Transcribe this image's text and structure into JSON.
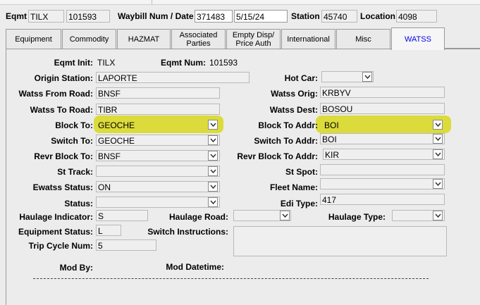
{
  "header": {
    "eqmt_label": "Eqmt",
    "eqmt_init": "TILX",
    "eqmt_num": "101593",
    "waybill_label": "Waybill Num / Date",
    "waybill_num": "371483",
    "waybill_date": "5/15/24",
    "station_label": "Station",
    "station": "45740",
    "location_label": "Location",
    "location": "4098"
  },
  "tabs": [
    {
      "label": "Equipment"
    },
    {
      "label": "Commodity"
    },
    {
      "label": "HAZMAT"
    },
    {
      "label": "Associated Parties"
    },
    {
      "label": "Empty Disp/ Price Auth"
    },
    {
      "label": "International"
    },
    {
      "label": "Misc"
    },
    {
      "label": "WATSS"
    }
  ],
  "form": {
    "eqmt_init_label": "Eqmt Init:",
    "eqmt_init": "TILX",
    "eqmt_num_label": "Eqmt Num:",
    "eqmt_num": "101593",
    "origin_station_label": "Origin Station:",
    "origin_station": "LAPORTE",
    "hot_car_label": "Hot Car:",
    "hot_car": "",
    "watss_from_road_label": "Watss From Road:",
    "watss_from_road": "BNSF",
    "watss_orig_label": "Watss Orig:",
    "watss_orig": "KRBYV",
    "watss_to_road_label": "Watss To Road:",
    "watss_to_road": "TIBR",
    "watss_dest_label": "Watss Dest:",
    "watss_dest": "BOSOU",
    "block_to_label": "Block To:",
    "block_to": "GEOCHE",
    "block_to_addr_label": "Block To Addr:",
    "block_to_addr": "BOI",
    "switch_to_label": "Switch To:",
    "switch_to": "GEOCHE",
    "switch_to_addr_label": "Switch To Addr:",
    "switch_to_addr": "BOI",
    "revr_block_to_label": "Revr Block To:",
    "revr_block_to": "BNSF",
    "revr_block_to_addr_label": "Revr Block To Addr:",
    "revr_block_to_addr": "KIR",
    "st_track_label": "St Track:",
    "st_track": "",
    "st_spot_label": "St Spot:",
    "st_spot": "",
    "ewatss_status_label": "Ewatss Status:",
    "ewatss_status": "ON",
    "fleet_name_label": "Fleet Name:",
    "fleet_name": "",
    "status_label": "Status:",
    "status": "",
    "edi_type_label": "Edi Type:",
    "edi_type": "417",
    "haulage_indicator_label": "Haulage Indicator:",
    "haulage_indicator": "S",
    "haulage_road_label": "Haulage Road:",
    "haulage_road": "",
    "haulage_type_label": "Haulage Type:",
    "haulage_type": "",
    "equipment_status_label": "Equipment Status:",
    "equipment_status": "L",
    "switch_instructions_label": "Switch Instructions:",
    "switch_instructions": "",
    "trip_cycle_num_label": "Trip Cycle Num:",
    "trip_cycle_num": "5",
    "mod_by_label": "Mod By:",
    "mod_datetime_label": "Mod Datetime:"
  },
  "colors": {
    "active_tab_text": "#0000ee",
    "highlight": "#d6d600"
  }
}
